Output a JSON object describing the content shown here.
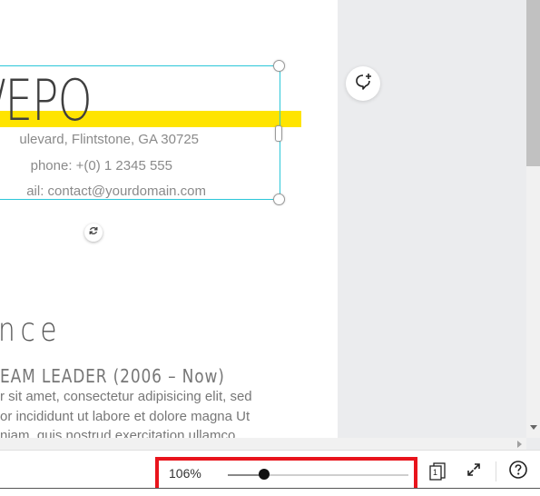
{
  "design": {
    "name_fragment": "/EPO",
    "contact": {
      "address_line": "ulevard, Flintstone, GA 30725",
      "phone_line": "phone: +(0) 1 2345 555",
      "email_line": "ail: contact@yourdomain.com"
    },
    "section_heading": "nce",
    "job_title": "EAM LEADER (2006 – Now)",
    "body_lines": [
      "r sit amet, consectetur adipisicing elit, sed",
      "or incididunt ut labore et dolore magna Ut",
      "niam, quis nostrud exercitation ullamco"
    ],
    "highlight_color": "#ffe400",
    "selection_color": "#2bc7d9"
  },
  "toolbar": {
    "zoom_label": "106%",
    "zoom_level": 0.2,
    "pages_count": "1",
    "highlight_border_color": "#e8141c"
  },
  "icons": {
    "comment": "add-comment-icon",
    "rotate": "rotate-icon",
    "pages": "pages-icon",
    "fullscreen": "fullscreen-icon",
    "help": "help-icon"
  }
}
